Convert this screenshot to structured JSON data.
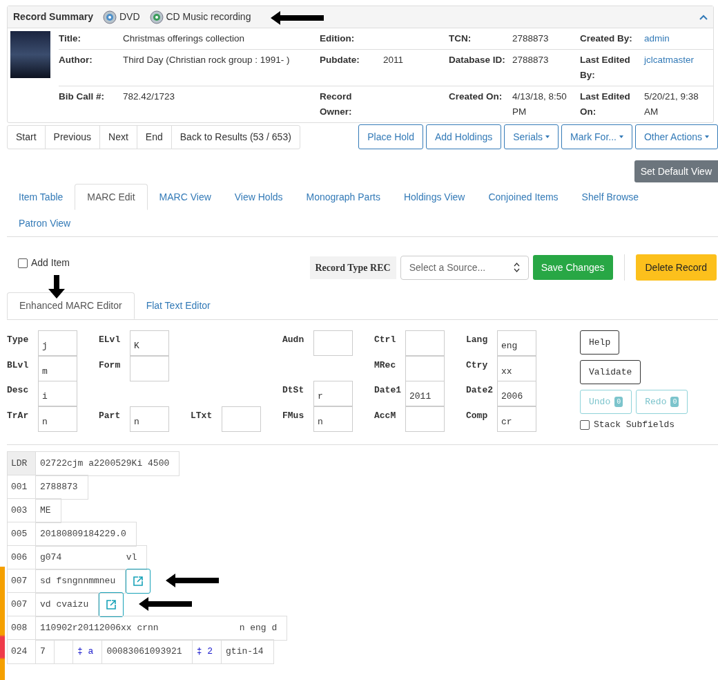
{
  "summary": {
    "title": "Record Summary",
    "formats": [
      {
        "kind": "dvd",
        "label": "DVD"
      },
      {
        "kind": "cd",
        "label": "CD Music recording"
      }
    ],
    "expanded": true,
    "rows": [
      [
        {
          "label": "Title:",
          "value": "Christmas offerings collection",
          "link": false
        },
        {
          "label": "Edition:"
        },
        {
          "label": "TCN:",
          "value": "2788873",
          "link": false
        },
        {
          "label": "Created By:",
          "value": "admin",
          "link": true
        }
      ],
      [
        {
          "label": "Author:",
          "value": "Third Day (Christian rock group : 1991- )",
          "link": false
        },
        {
          "label": "Pubdate:",
          "value": "2011",
          "link": false
        },
        {
          "label": "Database ID:",
          "value": "2788873",
          "link": false
        },
        {
          "label": "Last Edited By:",
          "value": "jclcatmaster",
          "link": true
        }
      ],
      [
        {
          "label": "Bib Call #:",
          "value": "782.42/1723",
          "link": false
        },
        {
          "label": "Record Owner:"
        },
        {
          "label": "Created On:",
          "value": "4/13/18, 8:50 PM",
          "link": false
        },
        {
          "label": "Last Edited On:",
          "value": "5/20/21, 9:38 AM",
          "link": false
        }
      ]
    ]
  },
  "nav_buttons": [
    "Start",
    "Previous",
    "Next",
    "End",
    "Back to Results (53 / 653)"
  ],
  "actions": [
    {
      "label": "Place Hold",
      "dropdown": false
    },
    {
      "label": "Add Holdings",
      "dropdown": false
    },
    {
      "label": "Serials",
      "dropdown": true
    },
    {
      "label": "Mark For...",
      "dropdown": true
    },
    {
      "label": "Other Actions",
      "dropdown": true
    }
  ],
  "default_view_button": "Set Default View",
  "tabs": [
    {
      "label": "Item Table",
      "selected": false
    },
    {
      "label": "MARC Edit",
      "selected": true
    },
    {
      "label": "MARC View",
      "selected": false
    },
    {
      "label": "View Holds",
      "selected": false
    },
    {
      "label": "Monograph Parts",
      "selected": false
    },
    {
      "label": "Holdings View",
      "selected": false
    },
    {
      "label": "Conjoined Items",
      "selected": false
    },
    {
      "label": "Shelf Browse",
      "selected": false
    },
    {
      "label": "Patron View",
      "selected": false
    }
  ],
  "toolbar": {
    "add_item": {
      "label": "Add Item",
      "checked": false
    },
    "record_type": "Record Type REC",
    "source": {
      "placeholder": "Select a Source..."
    },
    "save": "Save Changes",
    "delete": "Delete Record"
  },
  "editor_tabs": [
    {
      "label": "Enhanced MARC Editor",
      "selected": true
    },
    {
      "label": "Flat Text Editor",
      "selected": false
    }
  ],
  "fixed_fields": [
    {
      "label": "Type",
      "value": "j"
    },
    {
      "label": "ELvl",
      "value": "K"
    },
    {
      "label": "Audn"
    },
    {
      "label": "Ctrl"
    },
    {
      "label": "Lang",
      "value": "eng"
    },
    {
      "label": "BLvl",
      "value": "m"
    },
    {
      "label": "Form"
    },
    {
      "label": "MRec"
    },
    {
      "label": "Ctry",
      "value": "xx"
    },
    {
      "label": "Desc",
      "value": "i"
    },
    {
      "label": "DtSt",
      "value": "r"
    },
    {
      "label": "Date1",
      "value": "2011"
    },
    {
      "label": "Date2",
      "value": "2006"
    },
    {
      "label": "TrAr",
      "value": "n"
    },
    {
      "label": "Part",
      "value": "n"
    },
    {
      "label": "LTxt"
    },
    {
      "label": "FMus",
      "value": "n"
    },
    {
      "label": "AccM"
    },
    {
      "label": "Comp",
      "value": "cr"
    }
  ],
  "editor_buttons": [
    "Help",
    "Validate"
  ],
  "history_buttons": [
    {
      "label": "Undo",
      "count": "0",
      "disabled": true
    },
    {
      "label": "Redo",
      "count": "0",
      "disabled": true
    }
  ],
  "stack_subfields": {
    "label": "Stack Subfields",
    "checked": false
  },
  "marc": [
    {
      "kind": "leader",
      "tag": "LDR",
      "cells": [
        {
          "kind": "data",
          "text": "02722cjm a2200529Ki 4500"
        }
      ]
    },
    {
      "kind": "field",
      "tag": "001",
      "cells": [
        {
          "kind": "data",
          "text": "2788873"
        }
      ]
    },
    {
      "kind": "field",
      "tag": "003",
      "cells": [
        {
          "kind": "data",
          "text": "ME"
        }
      ]
    },
    {
      "kind": "field",
      "tag": "005",
      "cells": [
        {
          "kind": "data",
          "text": "20180809184229.0"
        }
      ]
    },
    {
      "kind": "field",
      "tag": "006",
      "cells": [
        {
          "kind": "data",
          "text": "g074            vl"
        }
      ]
    },
    {
      "kind": "field",
      "tag": "007",
      "cells": [
        {
          "kind": "data",
          "text": "sd fsngnnmmneu"
        },
        {
          "kind": "edit"
        }
      ]
    },
    {
      "kind": "field",
      "tag": "007",
      "cells": [
        {
          "kind": "data",
          "text": "vd cvaizu"
        },
        {
          "kind": "edit"
        }
      ]
    },
    {
      "kind": "field",
      "tag": "008",
      "cells": [
        {
          "kind": "data",
          "text": "110902r20112006xx crnn               n eng d"
        }
      ]
    },
    {
      "kind": "field",
      "tag": "024",
      "cells": [
        {
          "kind": "indicator",
          "text": "7"
        },
        {
          "kind": "indicator"
        },
        {
          "kind": "code",
          "text": "‡ a"
        },
        {
          "kind": "data",
          "text": "00083061093921"
        },
        {
          "kind": "code",
          "text": "‡ 2"
        },
        {
          "kind": "data",
          "text": "gtin-14"
        }
      ]
    }
  ]
}
